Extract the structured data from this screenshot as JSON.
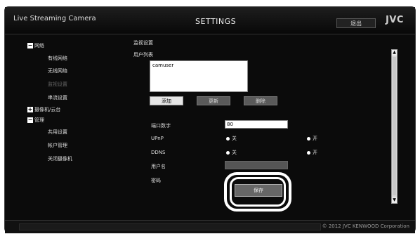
{
  "header": {
    "app_title": "Live Streaming Camera",
    "page_title": "SETTINGS",
    "logout_label": "退出",
    "brand": "JVC"
  },
  "sidebar": {
    "items": [
      {
        "label": "网络",
        "type": "group",
        "icon": "collapse-icon"
      },
      {
        "label": "有线网络"
      },
      {
        "label": "无线网络"
      },
      {
        "label": "监视设置",
        "disabled": true
      },
      {
        "label": "串流设置"
      },
      {
        "label": "摄像机/云台",
        "type": "group",
        "icon": "expand-icon"
      },
      {
        "label": "管理",
        "type": "group",
        "icon": "collapse-icon"
      },
      {
        "label": "共用设置"
      },
      {
        "label": "帐户管理"
      },
      {
        "label": "关闭摄像机"
      }
    ]
  },
  "main": {
    "section_title": "监视设置",
    "user_list_label": "用户列表",
    "user_list_items": [
      "camuser"
    ],
    "buttons": {
      "add": "添加",
      "update": "更新",
      "delete": "删除",
      "save": "保存"
    },
    "port_label": "端口数字",
    "port_value": "80",
    "upnp_label": "UPnP",
    "ddns_label": "DDNS",
    "off_label": "关",
    "on_label": "开",
    "username_label": "用户名",
    "password_label": "密码"
  },
  "footer": {
    "copyright": "© 2012 JVC KENWOOD Corporation"
  }
}
